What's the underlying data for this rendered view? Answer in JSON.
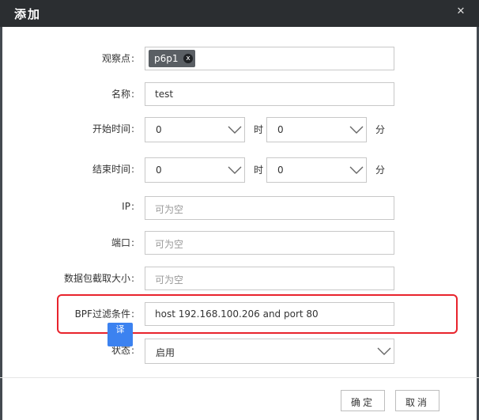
{
  "dialog": {
    "title": "添加",
    "close_icon": "close-icon"
  },
  "form": {
    "observation": {
      "label": "观察点",
      "colon": ":",
      "chip": "p6p1",
      "chip_remove": "x"
    },
    "name": {
      "label": "名称",
      "colon": ":",
      "value": "test"
    },
    "start_time": {
      "label": "开始时间",
      "colon": ":",
      "hour_value": "0",
      "hour_unit": "时",
      "minute_value": "0",
      "minute_unit": "分"
    },
    "end_time": {
      "label": "结束时间",
      "colon": ":",
      "hour_value": "0",
      "hour_unit": "时",
      "minute_value": "0",
      "minute_unit": "分"
    },
    "ip": {
      "label": "IP",
      "colon": ":",
      "placeholder": "可为空"
    },
    "port": {
      "label": "端口",
      "colon": ":",
      "placeholder": "可为空"
    },
    "packet_size": {
      "label": "数据包截取大小",
      "colon": ":",
      "placeholder": "可为空"
    },
    "bpf": {
      "label": "BPF过滤条件",
      "colon": ":",
      "value": "host 192.168.100.206 and port 80"
    },
    "status": {
      "label": "状态",
      "colon": ":",
      "value": "启用"
    }
  },
  "overlay": {
    "translate_badge": "译"
  },
  "footer": {
    "confirm": "确定",
    "cancel": "取消"
  },
  "colors": {
    "titlebar": "#2b2e31",
    "highlight": "#e8232c",
    "badge": "#3c82f0"
  }
}
